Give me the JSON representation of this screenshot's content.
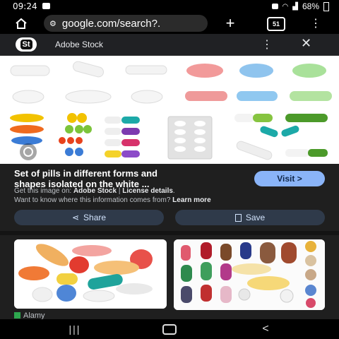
{
  "status": {
    "time": "09:24",
    "battery": "68%"
  },
  "browser": {
    "url": "google.com/search?.",
    "tab_count": "51"
  },
  "source_bar": {
    "logo_text": "St",
    "title": "Adobe Stock"
  },
  "result": {
    "title_line1": "Set of pills in different forms and",
    "title_line2": "shapes isolated on the white ...",
    "get_prefix": "Get this image on: ",
    "source_name": "Adobe Stock",
    "separator": " | ",
    "license": "License details",
    "license_end": ".",
    "want_text": "Want to know where this information comes from? ",
    "learn_more": "Learn more",
    "visit_label": "Visit >"
  },
  "actions": {
    "share_label": "Share",
    "save_label": "Save"
  },
  "related": {
    "source1": "Alamy"
  },
  "colors": {
    "accent": "#8ab4f8",
    "background": "#1f1f1f"
  }
}
